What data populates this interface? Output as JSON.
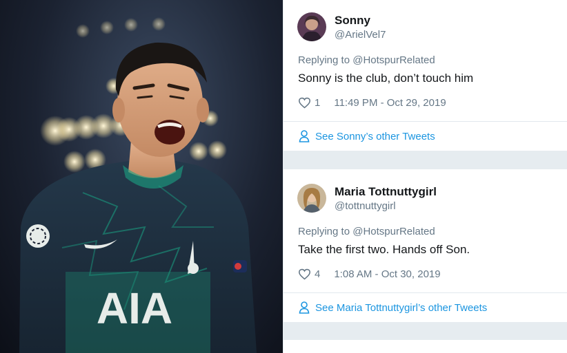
{
  "colors": {
    "link": "#1b95e0",
    "secondary_text": "#657786",
    "primary_text": "#14171a",
    "background": "#e6ecf0",
    "card": "#ffffff",
    "shirt": "#1f2e3d",
    "shirt_accent": "#1aa384"
  },
  "photo": {
    "icon": "football-player-photo",
    "shirt_text": "AIA"
  },
  "tweets": [
    {
      "name": "Sonny",
      "handle": "@ArielVel7",
      "replying_prefix": "Replying to ",
      "replying_to": "@HotspurRelated",
      "text": "Sonny is the club, don’t touch him",
      "likes": "1",
      "timestamp": "11:49 PM - Oct 29, 2019",
      "see_more": "See Sonny’s other Tweets"
    },
    {
      "name": "Maria Tottnuttygirl",
      "handle": "@tottnuttygirl",
      "replying_prefix": "Replying to ",
      "replying_to": "@HotspurRelated",
      "text": "Take the first two. Hands off Son.",
      "likes": "4",
      "timestamp": "1:08 AM - Oct 30, 2019",
      "see_more": "See Maria Tottnuttygirl’s other Tweets"
    }
  ]
}
